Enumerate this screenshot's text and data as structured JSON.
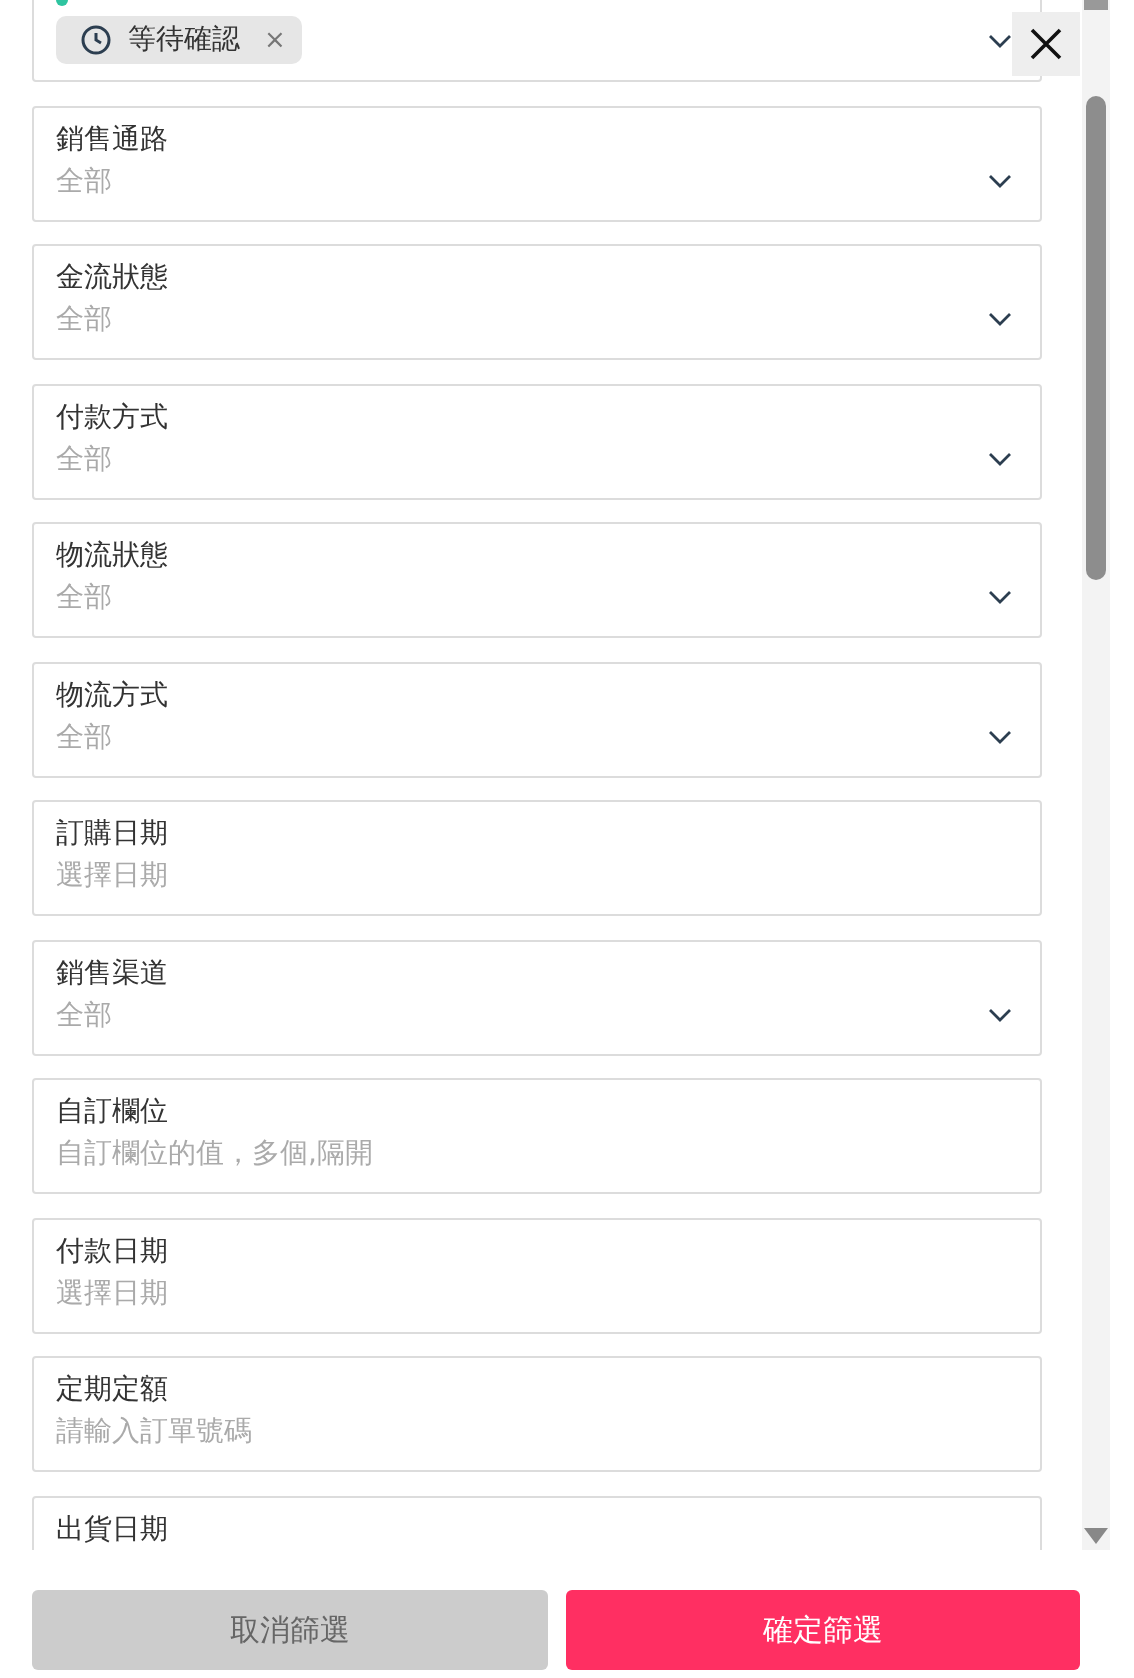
{
  "status_filter": {
    "chips": [
      {
        "label": "等待確認",
        "remove": "×"
      }
    ]
  },
  "fields": [
    {
      "label": "銷售通路",
      "placeholder": "全部",
      "kind": "select"
    },
    {
      "label": "金流狀態",
      "placeholder": "全部",
      "kind": "select"
    },
    {
      "label": "付款方式",
      "placeholder": "全部",
      "kind": "select"
    },
    {
      "label": "物流狀態",
      "placeholder": "全部",
      "kind": "select"
    },
    {
      "label": "物流方式",
      "placeholder": "全部",
      "kind": "select"
    },
    {
      "label": "訂購日期",
      "placeholder": "選擇日期",
      "kind": "text"
    },
    {
      "label": "銷售渠道",
      "placeholder": "全部",
      "kind": "select"
    },
    {
      "label": "自訂欄位",
      "placeholder": "自訂欄位的值，多個,隔開",
      "kind": "text"
    },
    {
      "label": "付款日期",
      "placeholder": "選擇日期",
      "kind": "text"
    },
    {
      "label": "定期定額",
      "placeholder": "請輸入訂單號碼",
      "kind": "text"
    },
    {
      "label": "出貨日期",
      "kind": "text"
    }
  ],
  "buttons": [
    {
      "label": "取消篩選",
      "kind": "secondary"
    },
    {
      "label": "確定篩選",
      "kind": "primary"
    }
  ]
}
